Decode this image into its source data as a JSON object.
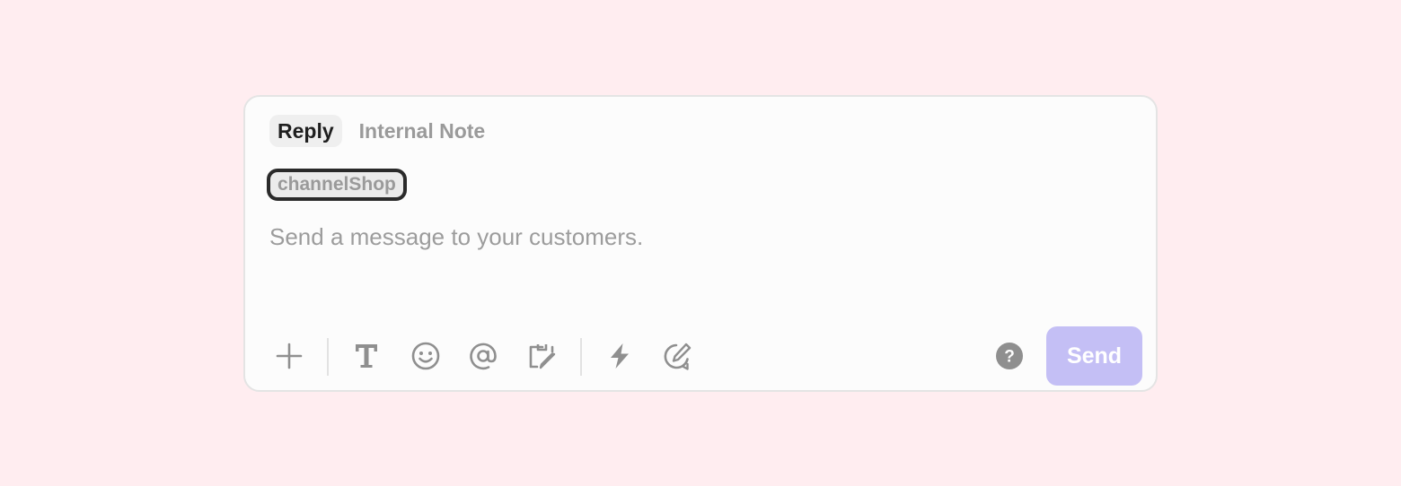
{
  "tabs": [
    {
      "label": "Reply",
      "active": true
    },
    {
      "label": "Internal Note",
      "active": false
    }
  ],
  "channel_chip": {
    "label": "channelShop"
  },
  "message": {
    "placeholder": "Send a message to your customers.",
    "value": ""
  },
  "toolbar": {
    "icons": [
      "plus-icon",
      "text-format-icon",
      "emoji-icon",
      "mention-icon",
      "template-icon",
      "lightning-icon",
      "compose-icon",
      "help-icon"
    ],
    "send_label": "Send"
  },
  "colors": {
    "page_background": "#ffedf0",
    "card_background": "#fcfcfc",
    "send_button": "#c4bff5",
    "icon_gray": "#8f8f8f",
    "chip_border": "#2a2a2a"
  }
}
